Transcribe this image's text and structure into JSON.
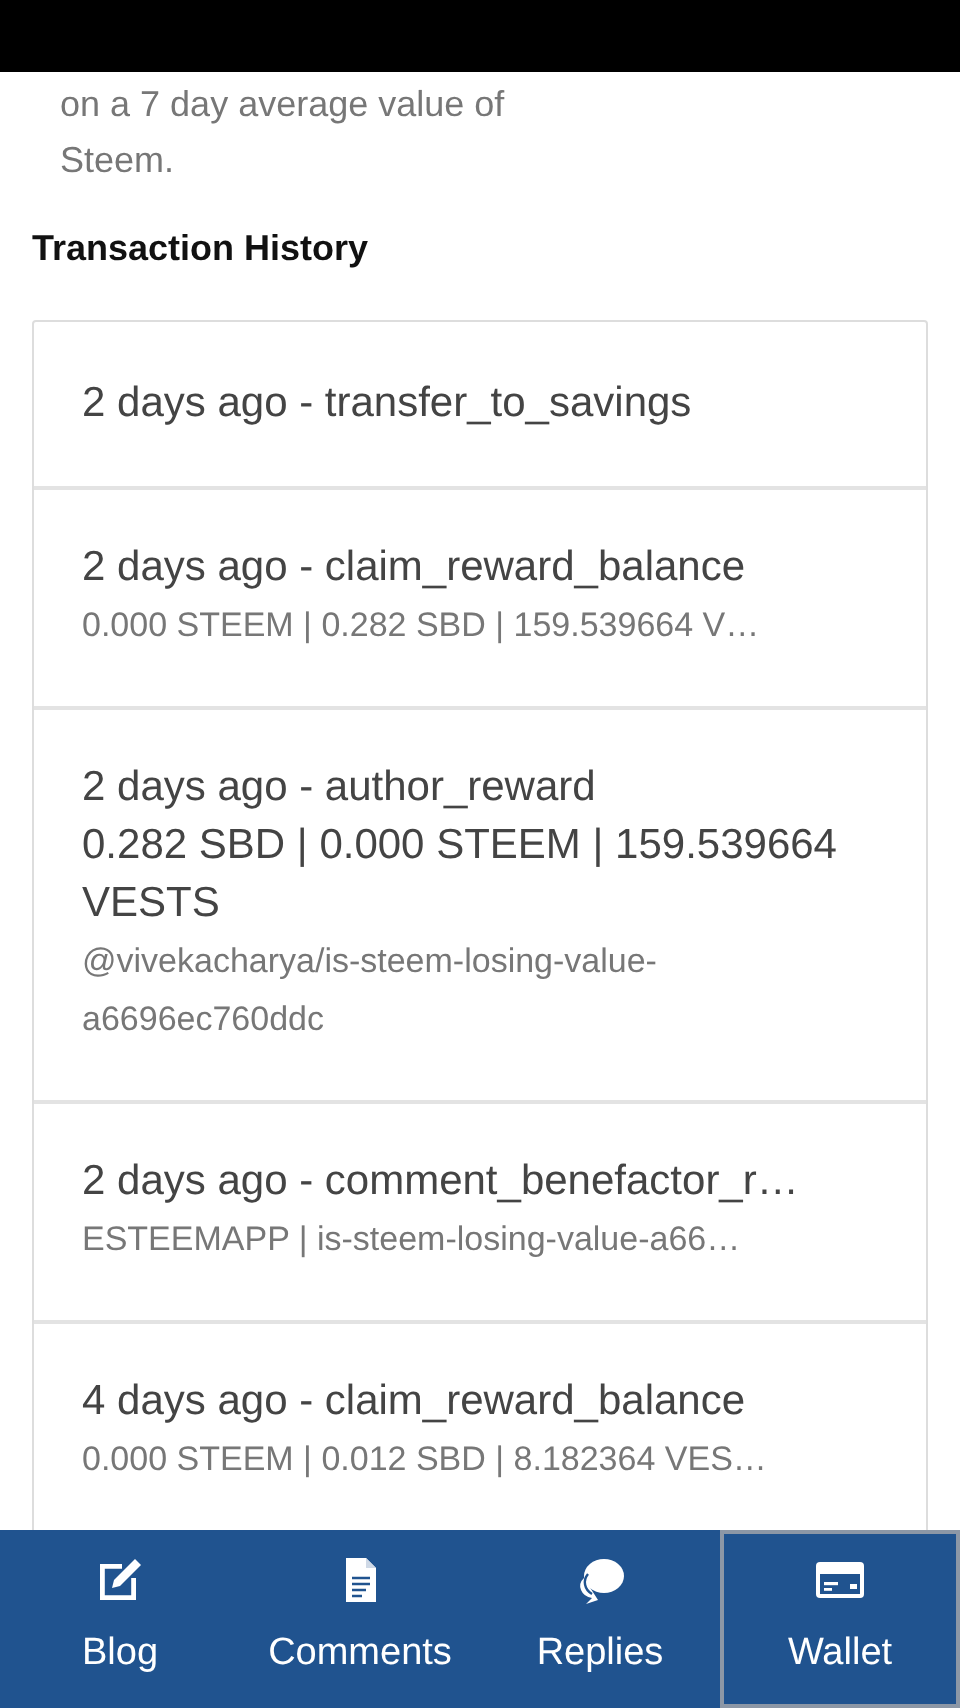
{
  "description": [
    "on a 7 day average value of",
    "Steem."
  ],
  "section_title": "Transaction History",
  "transactions": [
    {
      "title": "2 days ago - transfer_to_savings"
    },
    {
      "title": "2 days ago - claim_reward_balance",
      "memo": "0.000 STEEM | 0.282 SBD | 159.539664 V…"
    },
    {
      "title": "2 days ago - author_reward",
      "details": "0.282 SBD | 0.000 STEEM | 159.539664 VESTS",
      "memo": "@vivekacharya/is-steem-losing-value-a6696ec760ddc"
    },
    {
      "title": "2 days ago - comment_benefactor_r…",
      "memo": "ESTEEMAPP | is-steem-losing-value-a66…"
    },
    {
      "title": "4 days ago - claim_reward_balance",
      "memo": "0.000 STEEM | 0.012 SBD | 8.182364 VES…"
    }
  ],
  "bottom_nav": [
    {
      "kind": "blog",
      "label": "Blog",
      "selected": false
    },
    {
      "kind": "comments",
      "label": "Comments",
      "selected": false
    },
    {
      "kind": "replies",
      "label": "Replies",
      "selected": false
    },
    {
      "kind": "wallet",
      "label": "Wallet",
      "selected": true
    }
  ]
}
